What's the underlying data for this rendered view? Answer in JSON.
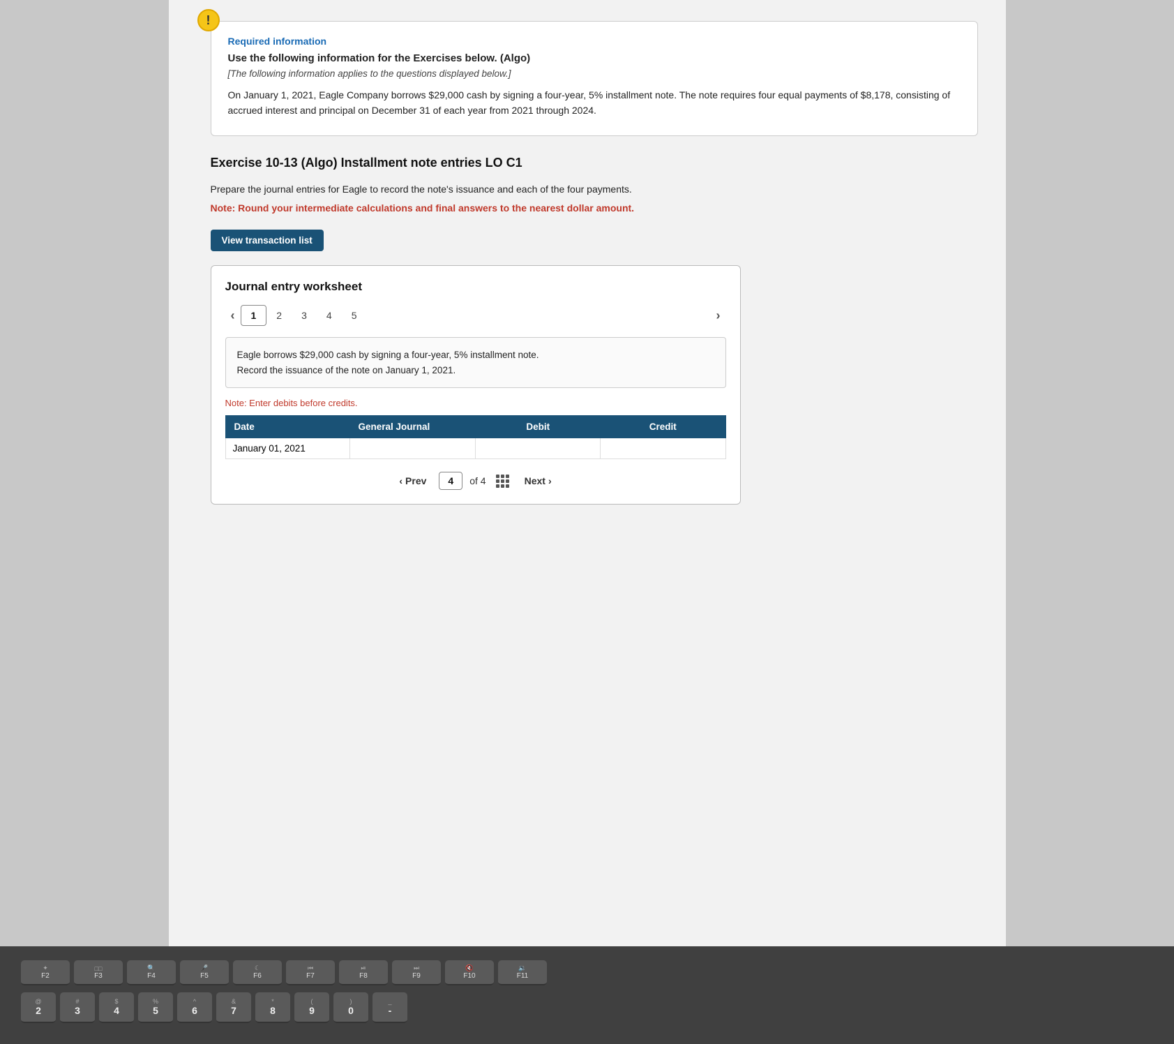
{
  "alert": {
    "icon": "!",
    "required_label": "Required information",
    "title": "Use the following information for the Exercises below. (Algo)",
    "subtitle": "[The following information applies to the questions displayed below.]",
    "body": "On January 1, 2021, Eagle Company borrows $29,000 cash by signing a four-year, 5% installment note. The note requires four equal payments of $8,178, consisting of accrued interest and principal on December 31 of each year from 2021 through 2024."
  },
  "exercise": {
    "title": "Exercise 10-13 (Algo) Installment note entries LO C1",
    "instructions": "Prepare the journal entries for Eagle to record the note's issuance and each of the four payments.",
    "note": "Note: Round your intermediate calculations and final answers to the nearest dollar amount.",
    "btn_view_transaction": "View transaction list"
  },
  "worksheet": {
    "title": "Journal entry worksheet",
    "tabs": [
      {
        "label": "1",
        "active": true
      },
      {
        "label": "2",
        "active": false
      },
      {
        "label": "3",
        "active": false
      },
      {
        "label": "4",
        "active": false
      },
      {
        "label": "5",
        "active": false
      }
    ],
    "description": "Eagle borrows $29,000 cash by signing a four-year, 5% installment note.\nRecord the issuance of the note on January 1, 2021.",
    "note_text": "Note: Enter debits before credits.",
    "table": {
      "headers": [
        "Date",
        "General Journal",
        "Debit",
        "Credit"
      ],
      "rows": [
        {
          "date": "January 01, 2021",
          "general_journal": "",
          "debit": "",
          "credit": ""
        }
      ]
    },
    "pagination": {
      "prev_label": "Prev",
      "current": "4",
      "total": "4",
      "next_label": "Next"
    }
  },
  "keyboard": {
    "fn_keys": [
      "F2",
      "F3",
      "F4",
      "F5",
      "F6",
      "F7",
      "F8",
      "F9",
      "F10",
      "F11"
    ],
    "num_row": [
      "@\n2",
      "#\n3",
      "$\n4",
      "%\n5",
      "^\n6",
      "&\n7",
      "*\n8",
      "(\n9",
      ")\n0",
      "-"
    ]
  }
}
